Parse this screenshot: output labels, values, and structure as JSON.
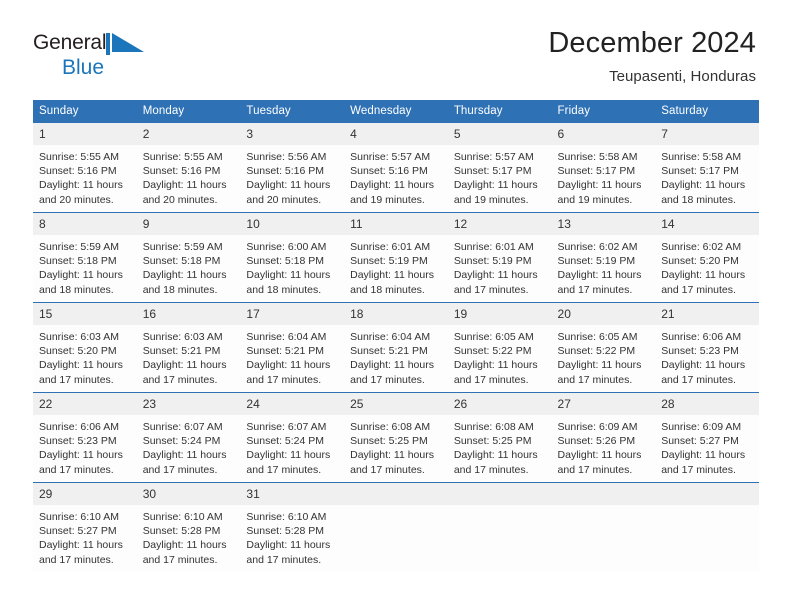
{
  "logo": {
    "text_top": "General",
    "text_bottom": "Blue",
    "mark_name": "blue-triangle-flag",
    "color_dark": "#231f20",
    "color_blue": "#1b75bb"
  },
  "header": {
    "title": "December 2024",
    "subtitle": "Teupasenti, Honduras"
  },
  "theme": {
    "header_blue": "#2e71b5",
    "daynum_band": "#f0f0f0",
    "text": "#333333"
  },
  "weekday_headers": [
    "Sunday",
    "Monday",
    "Tuesday",
    "Wednesday",
    "Thursday",
    "Friday",
    "Saturday"
  ],
  "weeks": [
    [
      {
        "day": "1",
        "sunrise": "Sunrise: 5:55 AM",
        "sunset": "Sunset: 5:16 PM",
        "daylight1": "Daylight: 11 hours",
        "daylight2": "and 20 minutes."
      },
      {
        "day": "2",
        "sunrise": "Sunrise: 5:55 AM",
        "sunset": "Sunset: 5:16 PM",
        "daylight1": "Daylight: 11 hours",
        "daylight2": "and 20 minutes."
      },
      {
        "day": "3",
        "sunrise": "Sunrise: 5:56 AM",
        "sunset": "Sunset: 5:16 PM",
        "daylight1": "Daylight: 11 hours",
        "daylight2": "and 20 minutes."
      },
      {
        "day": "4",
        "sunrise": "Sunrise: 5:57 AM",
        "sunset": "Sunset: 5:16 PM",
        "daylight1": "Daylight: 11 hours",
        "daylight2": "and 19 minutes."
      },
      {
        "day": "5",
        "sunrise": "Sunrise: 5:57 AM",
        "sunset": "Sunset: 5:17 PM",
        "daylight1": "Daylight: 11 hours",
        "daylight2": "and 19 minutes."
      },
      {
        "day": "6",
        "sunrise": "Sunrise: 5:58 AM",
        "sunset": "Sunset: 5:17 PM",
        "daylight1": "Daylight: 11 hours",
        "daylight2": "and 19 minutes."
      },
      {
        "day": "7",
        "sunrise": "Sunrise: 5:58 AM",
        "sunset": "Sunset: 5:17 PM",
        "daylight1": "Daylight: 11 hours",
        "daylight2": "and 18 minutes."
      }
    ],
    [
      {
        "day": "8",
        "sunrise": "Sunrise: 5:59 AM",
        "sunset": "Sunset: 5:18 PM",
        "daylight1": "Daylight: 11 hours",
        "daylight2": "and 18 minutes."
      },
      {
        "day": "9",
        "sunrise": "Sunrise: 5:59 AM",
        "sunset": "Sunset: 5:18 PM",
        "daylight1": "Daylight: 11 hours",
        "daylight2": "and 18 minutes."
      },
      {
        "day": "10",
        "sunrise": "Sunrise: 6:00 AM",
        "sunset": "Sunset: 5:18 PM",
        "daylight1": "Daylight: 11 hours",
        "daylight2": "and 18 minutes."
      },
      {
        "day": "11",
        "sunrise": "Sunrise: 6:01 AM",
        "sunset": "Sunset: 5:19 PM",
        "daylight1": "Daylight: 11 hours",
        "daylight2": "and 18 minutes."
      },
      {
        "day": "12",
        "sunrise": "Sunrise: 6:01 AM",
        "sunset": "Sunset: 5:19 PM",
        "daylight1": "Daylight: 11 hours",
        "daylight2": "and 17 minutes."
      },
      {
        "day": "13",
        "sunrise": "Sunrise: 6:02 AM",
        "sunset": "Sunset: 5:19 PM",
        "daylight1": "Daylight: 11 hours",
        "daylight2": "and 17 minutes."
      },
      {
        "day": "14",
        "sunrise": "Sunrise: 6:02 AM",
        "sunset": "Sunset: 5:20 PM",
        "daylight1": "Daylight: 11 hours",
        "daylight2": "and 17 minutes."
      }
    ],
    [
      {
        "day": "15",
        "sunrise": "Sunrise: 6:03 AM",
        "sunset": "Sunset: 5:20 PM",
        "daylight1": "Daylight: 11 hours",
        "daylight2": "and 17 minutes."
      },
      {
        "day": "16",
        "sunrise": "Sunrise: 6:03 AM",
        "sunset": "Sunset: 5:21 PM",
        "daylight1": "Daylight: 11 hours",
        "daylight2": "and 17 minutes."
      },
      {
        "day": "17",
        "sunrise": "Sunrise: 6:04 AM",
        "sunset": "Sunset: 5:21 PM",
        "daylight1": "Daylight: 11 hours",
        "daylight2": "and 17 minutes."
      },
      {
        "day": "18",
        "sunrise": "Sunrise: 6:04 AM",
        "sunset": "Sunset: 5:21 PM",
        "daylight1": "Daylight: 11 hours",
        "daylight2": "and 17 minutes."
      },
      {
        "day": "19",
        "sunrise": "Sunrise: 6:05 AM",
        "sunset": "Sunset: 5:22 PM",
        "daylight1": "Daylight: 11 hours",
        "daylight2": "and 17 minutes."
      },
      {
        "day": "20",
        "sunrise": "Sunrise: 6:05 AM",
        "sunset": "Sunset: 5:22 PM",
        "daylight1": "Daylight: 11 hours",
        "daylight2": "and 17 minutes."
      },
      {
        "day": "21",
        "sunrise": "Sunrise: 6:06 AM",
        "sunset": "Sunset: 5:23 PM",
        "daylight1": "Daylight: 11 hours",
        "daylight2": "and 17 minutes."
      }
    ],
    [
      {
        "day": "22",
        "sunrise": "Sunrise: 6:06 AM",
        "sunset": "Sunset: 5:23 PM",
        "daylight1": "Daylight: 11 hours",
        "daylight2": "and 17 minutes."
      },
      {
        "day": "23",
        "sunrise": "Sunrise: 6:07 AM",
        "sunset": "Sunset: 5:24 PM",
        "daylight1": "Daylight: 11 hours",
        "daylight2": "and 17 minutes."
      },
      {
        "day": "24",
        "sunrise": "Sunrise: 6:07 AM",
        "sunset": "Sunset: 5:24 PM",
        "daylight1": "Daylight: 11 hours",
        "daylight2": "and 17 minutes."
      },
      {
        "day": "25",
        "sunrise": "Sunrise: 6:08 AM",
        "sunset": "Sunset: 5:25 PM",
        "daylight1": "Daylight: 11 hours",
        "daylight2": "and 17 minutes."
      },
      {
        "day": "26",
        "sunrise": "Sunrise: 6:08 AM",
        "sunset": "Sunset: 5:25 PM",
        "daylight1": "Daylight: 11 hours",
        "daylight2": "and 17 minutes."
      },
      {
        "day": "27",
        "sunrise": "Sunrise: 6:09 AM",
        "sunset": "Sunset: 5:26 PM",
        "daylight1": "Daylight: 11 hours",
        "daylight2": "and 17 minutes."
      },
      {
        "day": "28",
        "sunrise": "Sunrise: 6:09 AM",
        "sunset": "Sunset: 5:27 PM",
        "daylight1": "Daylight: 11 hours",
        "daylight2": "and 17 minutes."
      }
    ],
    [
      {
        "day": "29",
        "sunrise": "Sunrise: 6:10 AM",
        "sunset": "Sunset: 5:27 PM",
        "daylight1": "Daylight: 11 hours",
        "daylight2": "and 17 minutes."
      },
      {
        "day": "30",
        "sunrise": "Sunrise: 6:10 AM",
        "sunset": "Sunset: 5:28 PM",
        "daylight1": "Daylight: 11 hours",
        "daylight2": "and 17 minutes."
      },
      {
        "day": "31",
        "sunrise": "Sunrise: 6:10 AM",
        "sunset": "Sunset: 5:28 PM",
        "daylight1": "Daylight: 11 hours",
        "daylight2": "and 17 minutes."
      },
      {
        "day": "",
        "sunrise": "",
        "sunset": "",
        "daylight1": "",
        "daylight2": ""
      },
      {
        "day": "",
        "sunrise": "",
        "sunset": "",
        "daylight1": "",
        "daylight2": ""
      },
      {
        "day": "",
        "sunrise": "",
        "sunset": "",
        "daylight1": "",
        "daylight2": ""
      },
      {
        "day": "",
        "sunrise": "",
        "sunset": "",
        "daylight1": "",
        "daylight2": ""
      }
    ]
  ]
}
